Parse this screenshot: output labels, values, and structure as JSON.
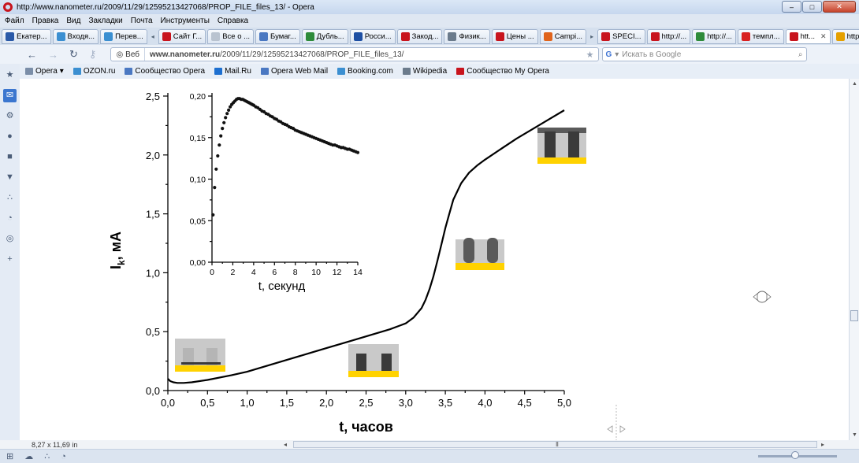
{
  "browser": {
    "window_title": "http://www.nanometer.ru/2009/11/29/12595213427068/PROP_FILE_files_13/ - Opera",
    "menu": [
      "Файл",
      "Правка",
      "Вид",
      "Закладки",
      "Почта",
      "Инструменты",
      "Справка"
    ],
    "tabs": [
      {
        "label": "Екатер...",
        "color": "#2b5aa8"
      },
      {
        "label": "Входя...",
        "color": "#3b8fd1"
      },
      {
        "label": "Перев...",
        "color": "#3b8fd1"
      },
      {
        "label": "Сайт Г...",
        "color": "#c8141d"
      },
      {
        "label": "Все о ...",
        "color": "#b9c3d0"
      },
      {
        "label": "Бумаг...",
        "color": "#4a78c2"
      },
      {
        "label": "Дубль...",
        "color": "#2e8b3a"
      },
      {
        "label": "Росси...",
        "color": "#1d4fa3"
      },
      {
        "label": "Закод...",
        "color": "#c8141d"
      },
      {
        "label": "Физик...",
        "color": "#6b7b8c"
      },
      {
        "label": "Цены ...",
        "color": "#c8141d"
      },
      {
        "label": "Campi...",
        "color": "#e0641c"
      },
      {
        "label": "SPECI...",
        "color": "#c8141d"
      },
      {
        "label": "http://...",
        "color": "#c8141d"
      },
      {
        "label": "http://...",
        "color": "#2e8b3a"
      },
      {
        "label": "темпл...",
        "color": "#d82020"
      },
      {
        "label": "htt...",
        "color": "#c8141d",
        "active": true
      },
      {
        "label": "http://...",
        "color": "#e5a000"
      }
    ],
    "address_mode": "Веб",
    "address_host": "www.nanometer.ru",
    "address_path": "/2009/11/29/12595213427068/PROP_FILE_files_13/",
    "search_placeholder": "Искать в Google",
    "bookmarks": [
      {
        "label": "Opera",
        "color": "#7b8ea8"
      },
      {
        "label": "OZON.ru",
        "color": "#3b8fd1"
      },
      {
        "label": "Сообщество Opera",
        "color": "#4a78c2"
      },
      {
        "label": "Mail.Ru",
        "color": "#1d6fd0"
      },
      {
        "label": "Opera Web Mail",
        "color": "#4a78c2"
      },
      {
        "label": "Booking.com",
        "color": "#3b8fd1"
      },
      {
        "label": "Wikipedia",
        "color": "#6b7b8c"
      },
      {
        "label": "Сообщество My Opera",
        "color": "#c8141d"
      }
    ],
    "page_size": "8,27 x 11,69 in",
    "side_icons": [
      "star-icon",
      "mail-icon",
      "gear-icon",
      "contacts-icon",
      "notes-icon",
      "transfers-icon",
      "links-icon",
      "history-icon",
      "feeds-icon",
      "add-panel-icon"
    ],
    "bottom_icons": [
      "panel-toggle-icon",
      "turbo-icon",
      "unite-icon",
      "unite-panel-icon"
    ],
    "zoom_percent": 100
  },
  "chart_data": [
    {
      "type": "line",
      "title": "",
      "xlabel": "t, часов",
      "ylabel": "I",
      "ylabel_sub": "k",
      "ylabel_suffix": ", мА",
      "xlim": [
        0,
        5
      ],
      "ylim": [
        0,
        2.5
      ],
      "xticks": [
        "0,0",
        "0,5",
        "1,0",
        "1,5",
        "2,0",
        "2,5",
        "3,0",
        "3,5",
        "4,0",
        "4,5",
        "5,0"
      ],
      "yticks": [
        "0,0",
        "0,5",
        "1,0",
        "1,5",
        "2,0",
        "2,5"
      ],
      "series": [
        {
          "x": [
            0.0,
            0.03,
            0.07,
            0.12,
            0.2,
            0.3,
            0.5,
            0.8,
            1.0,
            1.2,
            1.5,
            1.8,
            2.0,
            2.3,
            2.6,
            2.8,
            3.0,
            3.1,
            3.2,
            3.25,
            3.3,
            3.35,
            3.4,
            3.45,
            3.5,
            3.55,
            3.6,
            3.7,
            3.8,
            3.9,
            4.0,
            4.2,
            4.4,
            4.6,
            4.8,
            5.0
          ],
          "y": [
            0.1,
            0.08,
            0.07,
            0.065,
            0.065,
            0.07,
            0.09,
            0.13,
            0.16,
            0.2,
            0.26,
            0.32,
            0.36,
            0.42,
            0.48,
            0.52,
            0.57,
            0.62,
            0.7,
            0.77,
            0.86,
            0.97,
            1.1,
            1.24,
            1.38,
            1.5,
            1.62,
            1.76,
            1.85,
            1.91,
            1.96,
            2.05,
            2.14,
            2.22,
            2.3,
            2.38
          ]
        }
      ]
    },
    {
      "type": "scatter",
      "title": "",
      "xlabel": "t, секунд",
      "ylabel": "",
      "xlim": [
        0,
        14
      ],
      "ylim": [
        0,
        0.2
      ],
      "xticks": [
        "0",
        "2",
        "4",
        "6",
        "8",
        "10",
        "12",
        "14"
      ],
      "yticks": [
        "0,00",
        "0,05",
        "0,10",
        "0,15",
        "0,20"
      ],
      "series": [
        {
          "x": [
            0.1,
            0.25,
            0.4,
            0.55,
            0.7,
            0.85,
            1.0,
            1.15,
            1.3,
            1.45,
            1.6,
            1.75,
            1.9,
            2.05,
            2.2,
            2.35,
            2.5,
            2.65,
            2.8,
            2.95,
            3.1,
            3.25,
            3.4,
            3.55,
            3.7,
            3.85,
            4.0,
            4.2,
            4.4,
            4.6,
            4.8,
            5.0,
            5.2,
            5.4,
            5.6,
            5.8,
            6.0,
            6.2,
            6.4,
            6.6,
            6.8,
            7.0,
            7.2,
            7.4,
            7.6,
            7.8,
            8.0,
            8.2,
            8.4,
            8.6,
            8.8,
            9.0,
            9.2,
            9.4,
            9.6,
            9.8,
            10.0,
            10.2,
            10.4,
            10.6,
            10.8,
            11.0,
            11.2,
            11.4,
            11.6,
            11.8,
            12.0,
            12.2,
            12.4,
            12.6,
            12.8,
            13.0,
            13.2,
            13.4,
            13.6,
            13.8,
            14.0
          ],
          "y": [
            0.057,
            0.09,
            0.112,
            0.128,
            0.141,
            0.152,
            0.161,
            0.168,
            0.174,
            0.179,
            0.183,
            0.187,
            0.19,
            0.192,
            0.194,
            0.196,
            0.197,
            0.197,
            0.196,
            0.196,
            0.195,
            0.194,
            0.193,
            0.192,
            0.191,
            0.19,
            0.189,
            0.187,
            0.186,
            0.184,
            0.182,
            0.181,
            0.179,
            0.178,
            0.176,
            0.175,
            0.173,
            0.172,
            0.17,
            0.169,
            0.167,
            0.166,
            0.165,
            0.163,
            0.162,
            0.161,
            0.159,
            0.158,
            0.157,
            0.156,
            0.155,
            0.154,
            0.153,
            0.152,
            0.151,
            0.15,
            0.149,
            0.148,
            0.147,
            0.146,
            0.145,
            0.144,
            0.143,
            0.142,
            0.141,
            0.141,
            0.14,
            0.139,
            0.138,
            0.138,
            0.137,
            0.136,
            0.136,
            0.135,
            0.134,
            0.133,
            0.132
          ]
        }
      ]
    }
  ],
  "stage_colors": {
    "pore": "#b5b5b5",
    "wall": "#c9c9c9",
    "metal": "#3a3a3a",
    "base": "#ffd200",
    "cap": "#5a5a5a"
  }
}
